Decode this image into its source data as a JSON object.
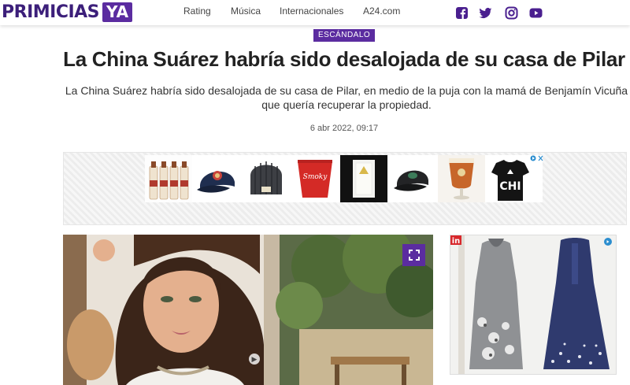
{
  "header": {
    "logo_text": "PRIMICIAS",
    "logo_badge": "YA",
    "nav": [
      "Rating",
      "Música",
      "Internacionales",
      "A24.com"
    ],
    "social_icons": [
      "facebook-icon",
      "twitter-icon",
      "instagram-icon",
      "youtube-icon"
    ]
  },
  "article": {
    "category": "ESCÁNDALO",
    "title": "La China Suárez habría sido desalojada de su casa de Pilar",
    "subtitle": "La China Suárez habría sido desalojada de su casa de Pilar, en medio de la puja con la mamá de Benjamín Vicuña que quería recuperar la propiedad.",
    "date": "6 abr 2022, 09:17"
  },
  "ads": {
    "strip_products": [
      "bottles",
      "cap-navy",
      "beanie-grey",
      "cup-red",
      "glass-white",
      "cap-black",
      "beer-glass",
      "chi-shirt"
    ],
    "cup_text": "Smoky",
    "chi_text": "CHI",
    "side_brand": "in"
  },
  "colors": {
    "brand": "#5b2ca0",
    "logo_text": "#3c1f7a"
  }
}
